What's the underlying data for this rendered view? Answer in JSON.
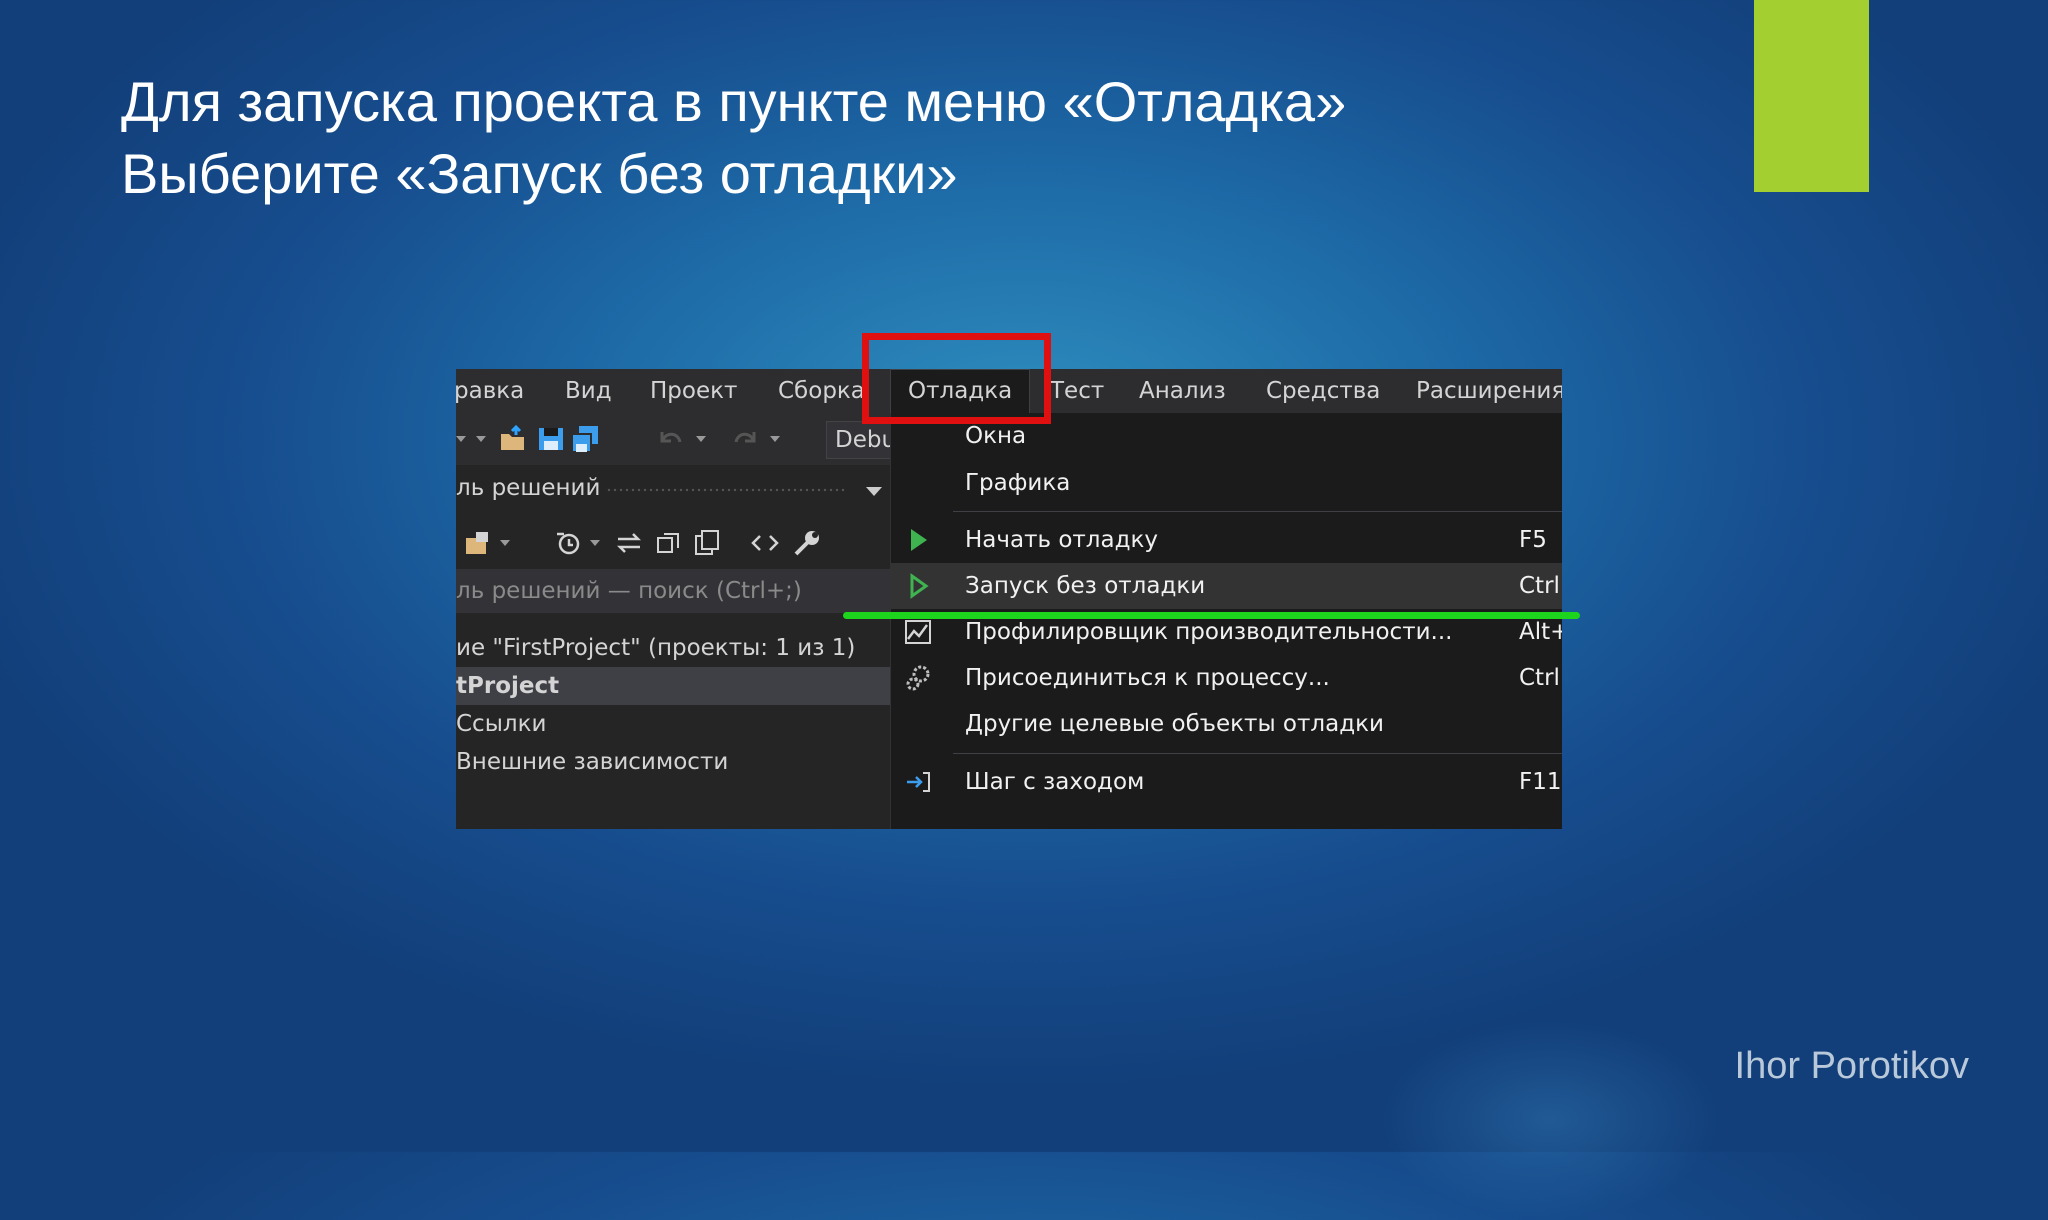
{
  "slide": {
    "title_line1": "Для запуска проекта в пункте меню «Отладка»",
    "title_line2": "Выберите «Запуск без отладки»",
    "author": "Ihor Porotikov",
    "accent_color": "#a4cf30"
  },
  "menubar": {
    "items": [
      "равка",
      "Вид",
      "Проект",
      "Сборка",
      "Отладка",
      "Тест",
      "Анализ",
      "Средства",
      "Расширения"
    ],
    "active": "Отладка"
  },
  "toolbar": {
    "config": "Debu",
    "icons": [
      "dropdown-icon",
      "open-folder-icon",
      "save-icon",
      "save-all-icon",
      "undo-icon",
      "redo-icon"
    ]
  },
  "solution_explorer": {
    "title": "ль решений",
    "search_placeholder": "ль решений — поиск (Ctrl+;)",
    "tree": [
      "ие \"FirstProject\" (проекты: 1 из 1)",
      "tProject",
      "Ссылки",
      "Внешние зависимости"
    ],
    "toolbar_icons": [
      "sync-icon",
      "history-icon",
      "switch-views-icon",
      "collapse-all-icon",
      "show-all-files-icon",
      "code-view-icon",
      "properties-wrench-icon"
    ]
  },
  "debug_menu": {
    "items": [
      {
        "label": "Окна",
        "shortcut": "",
        "icon": ""
      },
      {
        "label": "Графика",
        "shortcut": "",
        "icon": ""
      },
      {
        "label": "Начать отладку",
        "shortcut": "F5",
        "icon": "play-filled-icon"
      },
      {
        "label": "Запуск без отладки",
        "shortcut": "Ctrl",
        "icon": "play-outline-icon"
      },
      {
        "label": "Профилировщик производительности...",
        "shortcut": "Alt+",
        "icon": "performance-profiler-icon"
      },
      {
        "label": "Присоединиться к процессу...",
        "shortcut": "Ctrl",
        "icon": "attach-process-icon"
      },
      {
        "label": "Другие целевые объекты отладки",
        "shortcut": "",
        "icon": ""
      },
      {
        "label": "Шаг с заходом",
        "shortcut": "F11",
        "icon": "step-into-icon"
      }
    ]
  },
  "annotations": {
    "highlight_box_color": "#e01010",
    "underline_color": "#1ed51e"
  }
}
